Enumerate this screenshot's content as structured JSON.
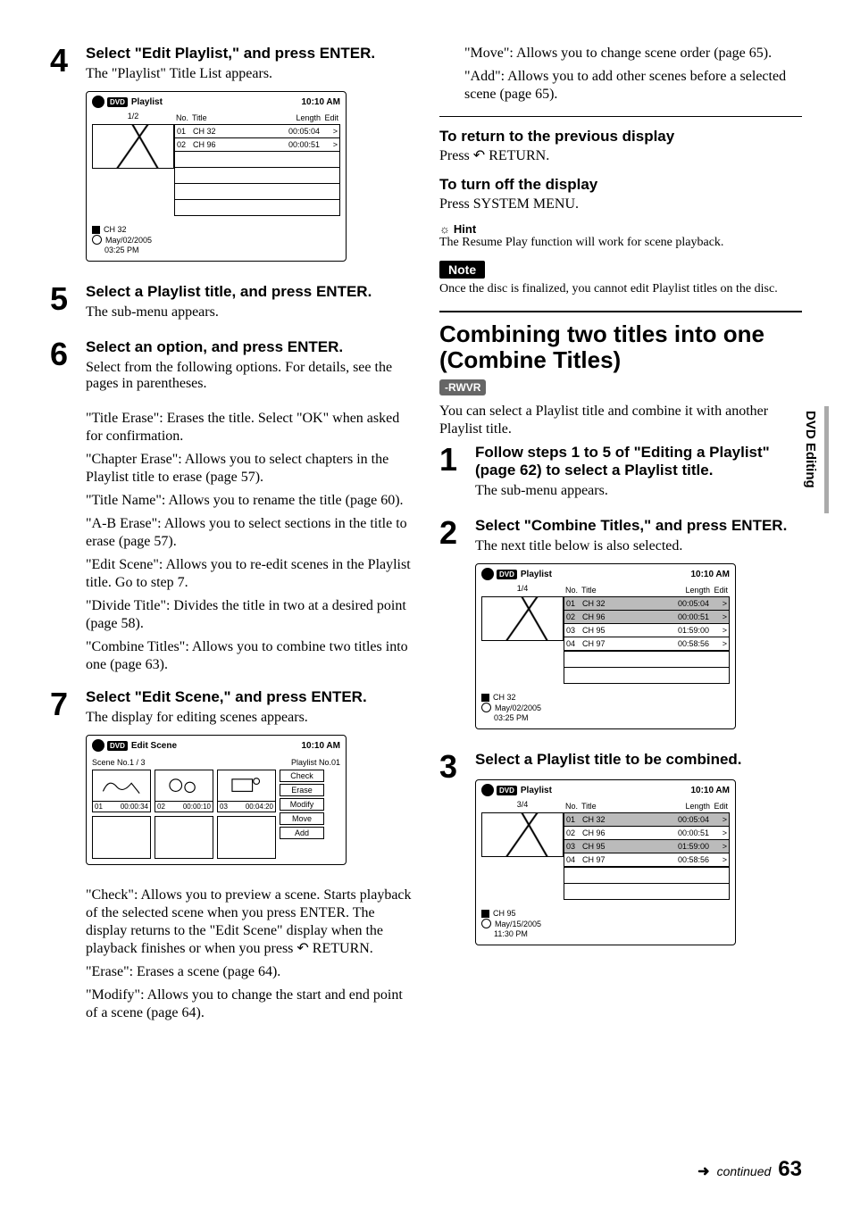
{
  "left": {
    "step4": {
      "num": "4",
      "head": "Select \"Edit Playlist,\" and press ENTER.",
      "sub": "The \"Playlist\" Title List appears."
    },
    "ui_playlist": {
      "title": "Playlist",
      "time": "10:10 AM",
      "frac": "1/2",
      "col_no": "No.",
      "col_title": "Title",
      "col_len": "Length",
      "col_edit": "Edit",
      "rows": [
        {
          "no": "01",
          "title": "CH 32",
          "len": "00:05:04",
          "edit": ">"
        },
        {
          "no": "02",
          "title": "CH 96",
          "len": "00:00:51",
          "edit": ">"
        }
      ],
      "foot_ch": "CH 32",
      "foot_date": "May/02/2005",
      "foot_time": "03:25  PM"
    },
    "step5": {
      "num": "5",
      "head": "Select a Playlist title, and press ENTER.",
      "sub": "The sub-menu appears."
    },
    "step6": {
      "num": "6",
      "head": "Select an option, and press ENTER.",
      "sub": "Select from the following options. For details, see the pages in parentheses.",
      "p1": "\"Title Erase\": Erases the title. Select \"OK\" when asked for confirmation.",
      "p2": "\"Chapter Erase\": Allows you to select chapters in the Playlist title to erase (page 57).",
      "p3": "\"Title Name\": Allows you to rename the title (page 60).",
      "p4": "\"A-B Erase\": Allows you to select sections in the title to erase (page 57).",
      "p5": "\"Edit Scene\": Allows you to re-edit scenes in the Playlist title. Go to step 7.",
      "p6": "\"Divide Title\": Divides the title in two at a desired point (page 58).",
      "p7": "\"Combine Titles\": Allows you to combine two titles into one (page 63)."
    },
    "step7": {
      "num": "7",
      "head": "Select \"Edit Scene,\" and press ENTER.",
      "sub": "The display for editing scenes appears."
    },
    "ui_scene": {
      "title": "Edit Scene",
      "time": "10:10 AM",
      "scene_no": "Scene No.1 / 3",
      "playlist_no": "Playlist No.01",
      "cells": [
        {
          "no": "01",
          "t": "00:00:34"
        },
        {
          "no": "02",
          "t": "00:00:10"
        },
        {
          "no": "03",
          "t": "00:04:20"
        }
      ],
      "btns": [
        "Check",
        "Erase",
        "Modify",
        "Move",
        "Add"
      ]
    },
    "after7": {
      "p1": "\"Check\": Allows you to preview a scene. Starts playback of the selected scene when you press ENTER. The display returns to the \"Edit Scene\" display when the playback finishes or when you press ↶ RETURN.",
      "p2": "\"Erase\": Erases a scene (page 64).",
      "p3": "\"Modify\": Allows you to change the start and end point of a scene (page 64)."
    }
  },
  "right": {
    "top": {
      "p1": "\"Move\": Allows you to change scene order (page 65).",
      "p2": "\"Add\": Allows you to add other scenes before a selected scene (page 65)."
    },
    "ret_h": "To return to the previous display",
    "ret_b": "Press ↶ RETURN.",
    "off_h": "To turn off the display",
    "off_b": "Press SYSTEM MENU.",
    "hint_label": "Hint",
    "hint_body": "The Resume Play function will work for scene playback.",
    "note_label": "Note",
    "note_body": "Once the disc is finalized, you cannot edit Playlist titles on the disc.",
    "section_h": "Combining two titles into one (Combine Titles)",
    "chip": "-RWVR",
    "section_intro": "You can select a Playlist title and combine it with another Playlist title.",
    "step1": {
      "num": "1",
      "head": "Follow steps 1 to 5 of \"Editing a Playlist\" (page 62) to select a Playlist title.",
      "sub": "The sub-menu appears."
    },
    "step2": {
      "num": "2",
      "head": "Select \"Combine Titles,\" and press ENTER.",
      "sub": "The next title below is also selected."
    },
    "ui_combine1": {
      "title": "Playlist",
      "time": "10:10 AM",
      "frac": "1/4",
      "col_no": "No.",
      "col_title": "Title",
      "col_len": "Length",
      "col_edit": "Edit",
      "rows": [
        {
          "no": "01",
          "title": "CH 32",
          "len": "00:05:04",
          "edit": ">",
          "sel": true
        },
        {
          "no": "02",
          "title": "CH 96",
          "len": "00:00:51",
          "edit": ">",
          "sel": true
        },
        {
          "no": "03",
          "title": "CH 95",
          "len": "01:59:00",
          "edit": ">"
        },
        {
          "no": "04",
          "title": "CH 97",
          "len": "00:58:56",
          "edit": ">"
        }
      ],
      "foot_ch": "CH 32",
      "foot_date": "May/02/2005",
      "foot_time": "03:25   PM"
    },
    "step3": {
      "num": "3",
      "head": "Select a Playlist title to be combined."
    },
    "ui_combine2": {
      "title": "Playlist",
      "time": "10:10 AM",
      "frac": "3/4",
      "col_no": "No.",
      "col_title": "Title",
      "col_len": "Length",
      "col_edit": "Edit",
      "rows": [
        {
          "no": "01",
          "title": "CH 32",
          "len": "00:05:04",
          "edit": ">",
          "sel": true
        },
        {
          "no": "02",
          "title": "CH 96",
          "len": "00:00:51",
          "edit": ">"
        },
        {
          "no": "03",
          "title": "CH 95",
          "len": "01:59:00",
          "edit": ">",
          "sel": true
        },
        {
          "no": "04",
          "title": "CH 97",
          "len": "00:58:56",
          "edit": ">"
        }
      ],
      "foot_ch": "CH 95",
      "foot_date": "May/15/2005",
      "foot_time": "11:30   PM"
    }
  },
  "tab": "DVD Editing",
  "footer": {
    "cont": "continued",
    "page": "63"
  }
}
